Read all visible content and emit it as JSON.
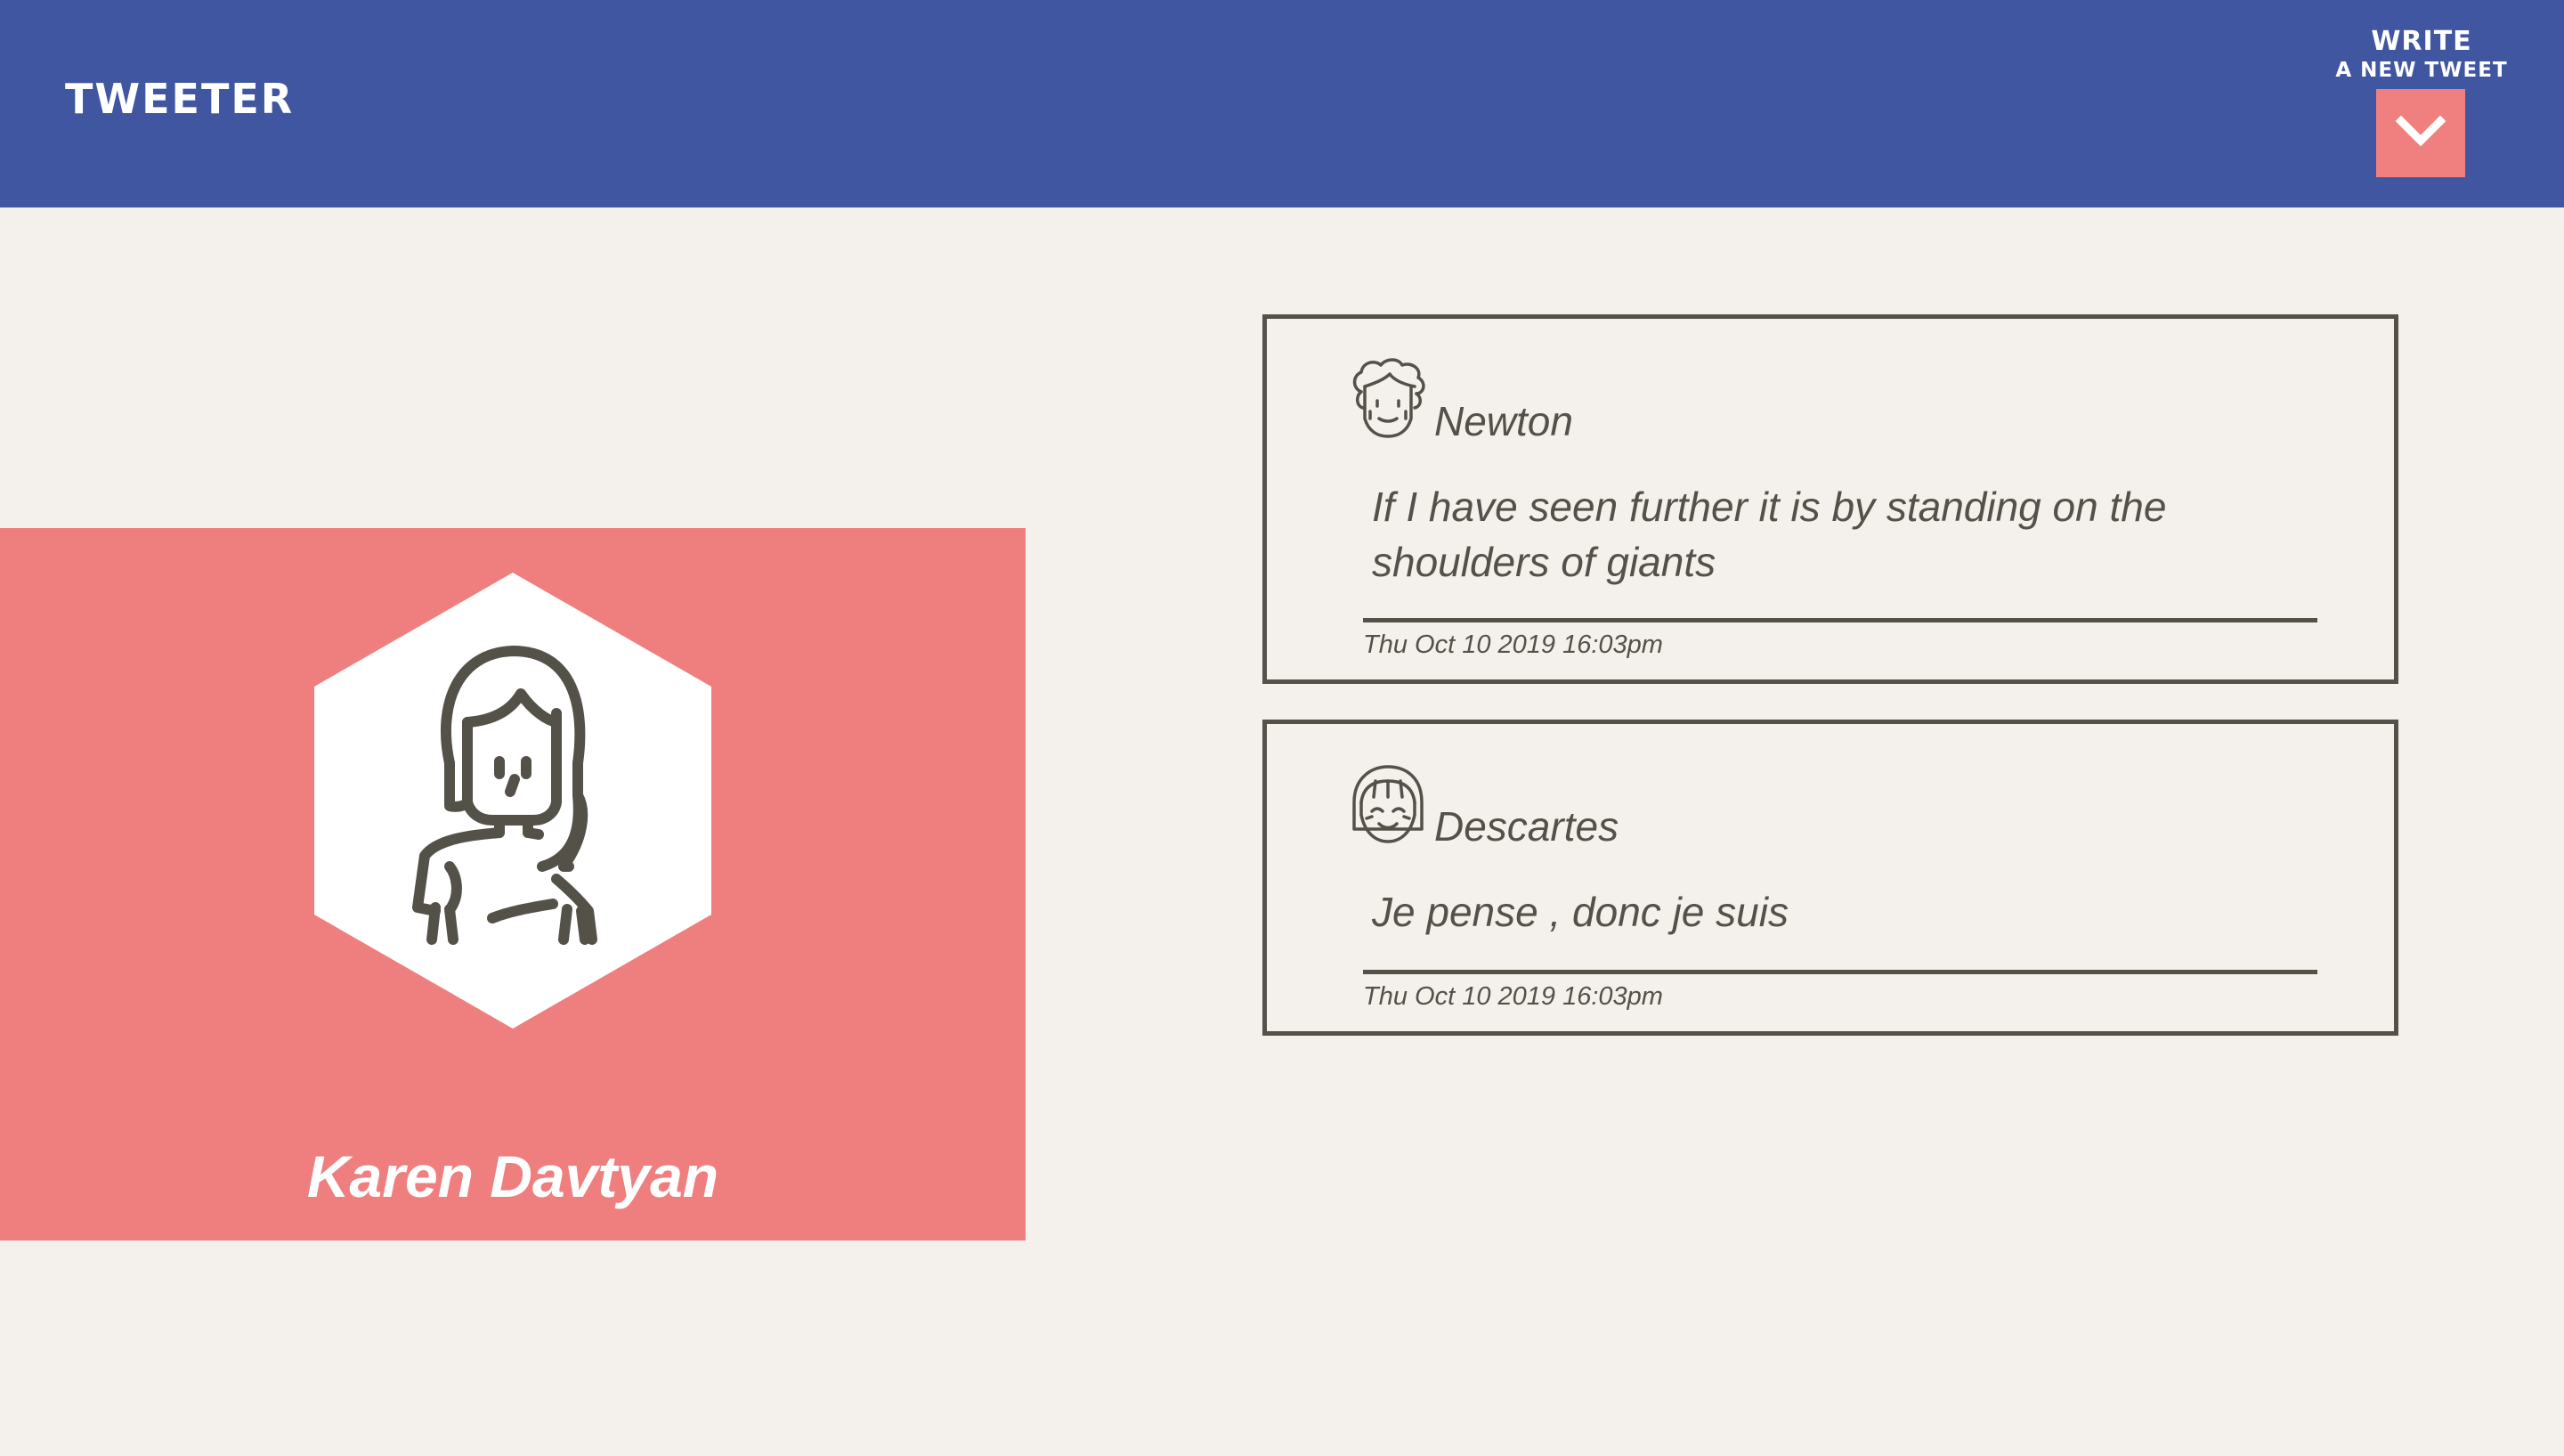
{
  "header": {
    "brand": "Tweeter",
    "compose": {
      "line1": "Write",
      "line2": "a new tweet",
      "icon": "chevron-down-icon"
    }
  },
  "profile": {
    "name": "Karen Davtyan",
    "avatar_icon": "woman-avatar-icon"
  },
  "tweets": [
    {
      "handle": "Newton",
      "avatar_icon": "curly-hair-face-icon",
      "text": "If I have seen further it is by standing on the shoulders of giants",
      "timestamp": "Thu Oct 10 2019 16:03pm"
    },
    {
      "handle": "Descartes",
      "avatar_icon": "bangs-face-icon",
      "text": "Je pense , donc je suis",
      "timestamp": "Thu Oct 10 2019 16:03pm"
    }
  ],
  "colors": {
    "header_bg": "#4056a1",
    "page_bg": "#f4f1ec",
    "accent": "#ef7f7f",
    "ink": "#545149"
  }
}
